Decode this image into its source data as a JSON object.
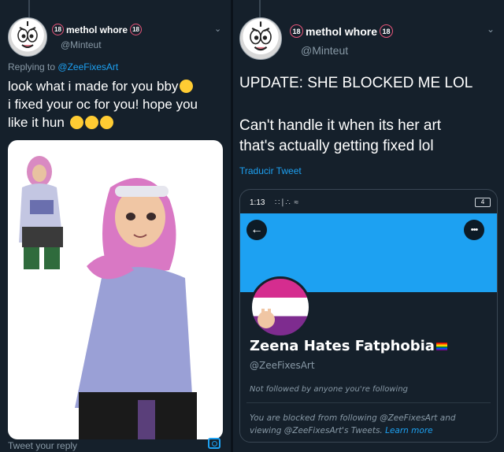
{
  "left_tweet": {
    "badge_left": "18",
    "display_name": "methol whore",
    "badge_right": "18",
    "handle": "@Minteut",
    "reply_prefix": "Replying to",
    "reply_to": "@ZeeFixesArt",
    "text_line1": "look what i made for you bby",
    "text_line2": "i fixed your oc for you! hope you",
    "text_line3": "like it hun",
    "reply_placeholder": "Tweet your reply",
    "icon_camera": "camera-icon",
    "icon_chevron": "chevron-down-icon"
  },
  "right_tweet": {
    "badge_left": "18",
    "display_name": "methol whore",
    "badge_right": "18",
    "handle": "@Minteut",
    "text_line1": "UPDATE: SHE BLOCKED ME LOL",
    "text_line2": "Can't handle it when its her art",
    "text_line3": "that's actually getting fixed lol",
    "translate": "Traducir Tweet"
  },
  "phone_screenshot": {
    "time": "1:13",
    "battery": "4",
    "back_icon": "back-arrow-icon",
    "more_icon": "more-dots-icon",
    "profile_name": "Zeena Hates Fatphobia",
    "profile_handle": "@ZeeFixesArt",
    "follow_status": "Not followed by anyone you're following",
    "blocked_text": "You are blocked from following @ZeeFixesArt and viewing @ZeeFixesArt's Tweets.",
    "learn_more": "Learn more",
    "banner_color": "#1da1f2"
  },
  "colors": {
    "background": "#15202b",
    "link": "#1da1f2",
    "muted": "#8899a6"
  }
}
